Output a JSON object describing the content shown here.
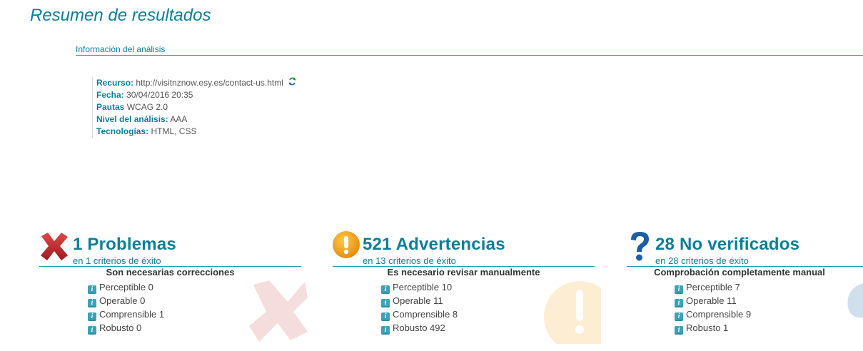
{
  "page": {
    "title": "Resumen de resultados"
  },
  "info": {
    "header": "Información del análisis",
    "rows": [
      {
        "label": "Recurso:",
        "value": "http://visitnznow.esy.es/contact-us.html"
      },
      {
        "label": "Fecha:",
        "value": "30/04/2016 20:35"
      },
      {
        "label": "Pautas",
        "value": "WCAG 2.0"
      },
      {
        "label": "Nivel del análisis:",
        "value": "AAA"
      },
      {
        "label": "Tecnologías:",
        "value": "HTML, CSS"
      }
    ]
  },
  "summaries": [
    {
      "heading": "1 Problemas",
      "sub": "en 1 criterios de éxito",
      "note": "Son necesarias correcciones",
      "icon": "error-x-icon",
      "color": "#c0272d",
      "items": [
        "Perceptible 0",
        "Operable 0",
        "Comprensible 1",
        "Robusto 0"
      ]
    },
    {
      "heading": "521 Advertencias",
      "sub": "en 13 criterios de éxito",
      "note": "Es necesario revisar manualmente",
      "icon": "warning-exclamation-icon",
      "color": "#f0a212",
      "items": [
        "Perceptible 10",
        "Operable 11",
        "Comprensible 8",
        "Robusto 492"
      ]
    },
    {
      "heading": "28 No verificados",
      "sub": "en 28 criterios de éxito",
      "note": "Comprobación completamente manual",
      "icon": "question-mark-icon",
      "color": "#1b5fa6",
      "items": [
        "Perceptible 7",
        "Operable 11",
        "Comprensible 9",
        "Robusto 1"
      ]
    }
  ]
}
